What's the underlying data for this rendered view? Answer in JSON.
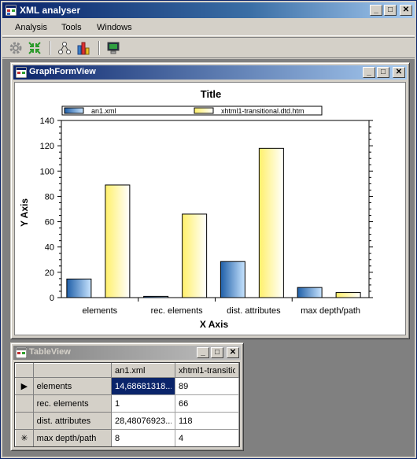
{
  "app": {
    "title": "XML analyser"
  },
  "menu": [
    "Analysis",
    "Tools",
    "Windows"
  ],
  "toolbar": {
    "icons": [
      "gear-icon",
      "compress-icon",
      "tree-icon",
      "bar-chart-icon",
      "monitor-icon"
    ]
  },
  "graph_window": {
    "title": "GraphFormView"
  },
  "table_window": {
    "title": "TableView",
    "columns": [
      "an1.xml",
      "xhtml1-transitional.dtd.htm"
    ],
    "rows": [
      {
        "marker": "▶",
        "name": "elements",
        "values": [
          "14,68681318...",
          "89"
        ],
        "selected": true
      },
      {
        "marker": "",
        "name": "rec. elements",
        "values": [
          "1",
          "66"
        ]
      },
      {
        "marker": "",
        "name": "dist. attributes",
        "values": [
          "28,48076923...",
          "118"
        ]
      },
      {
        "marker": "✳",
        "name": "max depth/path",
        "values": [
          "8",
          "4"
        ]
      }
    ]
  },
  "colors": {
    "series1": "#3a7fc8",
    "series2": "#fffaa0",
    "active_title": "#0a246a"
  },
  "chart_data": {
    "type": "bar",
    "title": "Title",
    "xlabel": "X Axis",
    "ylabel": "Y Axis",
    "ylim": [
      0,
      140
    ],
    "yticks": [
      0,
      20,
      40,
      60,
      80,
      100,
      120,
      140
    ],
    "categories": [
      "elements",
      "rec. elements",
      "dist. attributes",
      "max depth/path"
    ],
    "series": [
      {
        "name": "an1.xml",
        "values": [
          14.7,
          1,
          28.5,
          8
        ]
      },
      {
        "name": "xhtml1-transitional.dtd.htm",
        "values": [
          89,
          66,
          118,
          4
        ]
      }
    ],
    "legend_position": "top"
  }
}
